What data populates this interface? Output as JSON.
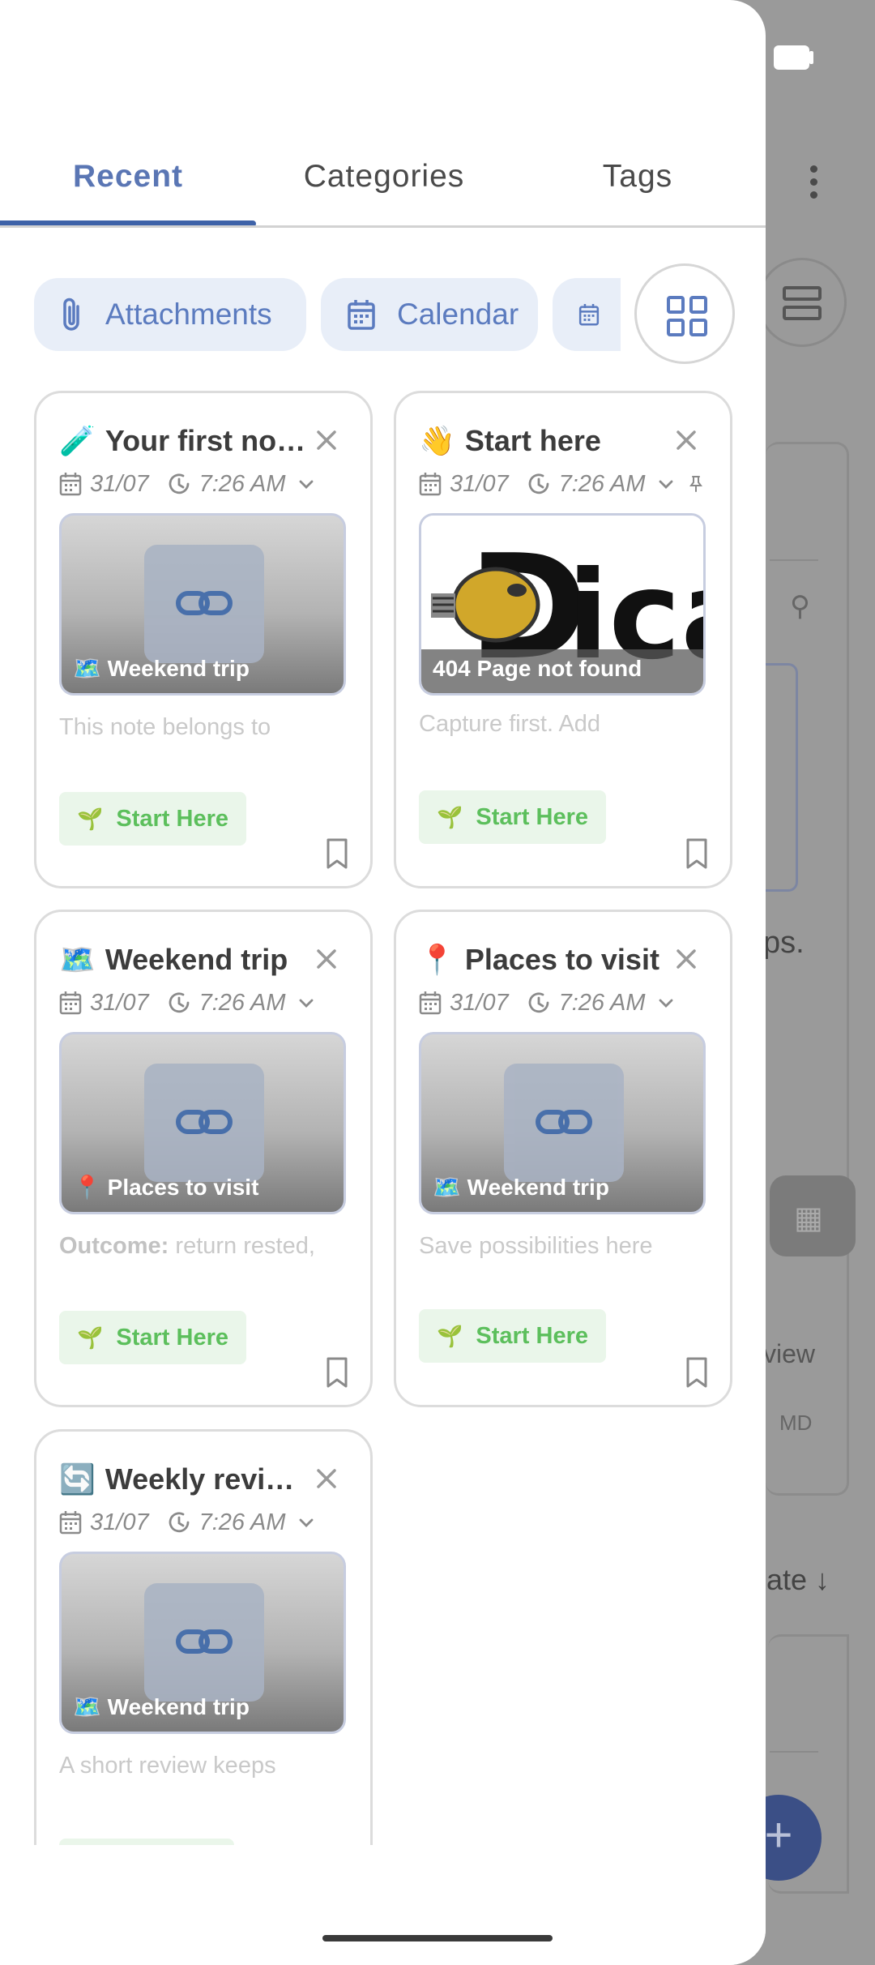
{
  "tabs": [
    {
      "label": "Recent",
      "active": true
    },
    {
      "label": "Categories",
      "active": false
    },
    {
      "label": "Tags",
      "active": false
    }
  ],
  "filter_chips": [
    {
      "label": "Attachments",
      "icon": "paperclip-icon"
    },
    {
      "label": "Calendar",
      "icon": "calendar-icon"
    },
    {
      "label": "",
      "icon": "calendar-icon"
    }
  ],
  "notes": [
    {
      "emoji": "🧪",
      "title": "Your first no…",
      "date": "31/07",
      "time": "7:26 AM",
      "preview_caption": "🗺️ Weekend trip",
      "preview_type": "link",
      "snippet": "This note belongs to",
      "snippet_bold": "",
      "tag": "Start Here",
      "pinned": false
    },
    {
      "emoji": "👋",
      "title": "Start here",
      "date": "31/07",
      "time": "7:26 AM",
      "preview_caption": "404 Page not found",
      "preview_type": "image",
      "preview_image_text": "Dica",
      "snippet": "Capture first. Add",
      "snippet_bold": "",
      "tag": "Start Here",
      "pinned": true
    },
    {
      "emoji": "🗺️",
      "title": "Weekend trip",
      "date": "31/07",
      "time": "7:26 AM",
      "preview_caption": "📍 Places to visit",
      "preview_type": "link",
      "snippet": "return rested,",
      "snippet_bold": "Outcome:",
      "tag": "Start Here",
      "pinned": false
    },
    {
      "emoji": "📍",
      "title": "Places to visit",
      "date": "31/07",
      "time": "7:26 AM",
      "preview_caption": "🗺️ Weekend trip",
      "preview_type": "link",
      "snippet": "Save possibilities here",
      "snippet_bold": "",
      "tag": "Start Here",
      "pinned": false
    },
    {
      "emoji": "🔄",
      "title": "Weekly revi…",
      "date": "31/07",
      "time": "7:26 AM",
      "preview_caption": "🗺️ Weekend trip",
      "preview_type": "link",
      "snippet": "A short review keeps",
      "snippet_bold": "",
      "tag": "",
      "pinned": false
    }
  ],
  "background": {
    "text_ps": "ps.",
    "text_view": "view",
    "text_md": "MD",
    "text_date": "late ↓",
    "fab_label": "+"
  },
  "colors": {
    "accent": "#3e62a8",
    "chip_bg": "#e8eef8",
    "tag_green": "#5cbf5c",
    "tag_bg": "#eaf6ea"
  }
}
